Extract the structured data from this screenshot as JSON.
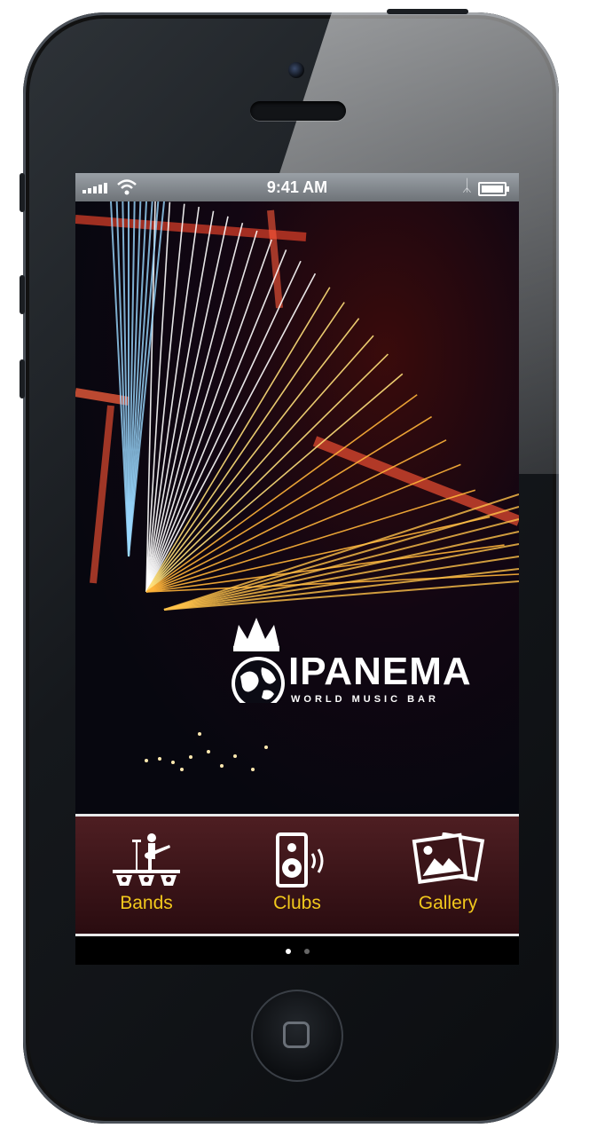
{
  "status_bar": {
    "time": "9:41 AM",
    "signal_icon": "signal-bars-icon",
    "wifi_icon": "wifi-icon",
    "bluetooth_icon": "bluetooth-icon",
    "battery_icon": "battery-icon"
  },
  "hero": {
    "brand": "IPANEMA",
    "tagline": "WORLD MUSIC BAR",
    "logo_icon": "crown-globe-logo"
  },
  "tabs": [
    {
      "label": "Bands",
      "icon": "band-stage-icon"
    },
    {
      "label": "Clubs",
      "icon": "speaker-icon"
    },
    {
      "label": "Gallery",
      "icon": "photo-gallery-icon"
    }
  ],
  "pager": {
    "pages": 2,
    "current": 1
  },
  "colors": {
    "tab_label": "#f2c81c",
    "tab_bar": "#4e1e22",
    "status_bar": "#8a8f94"
  }
}
